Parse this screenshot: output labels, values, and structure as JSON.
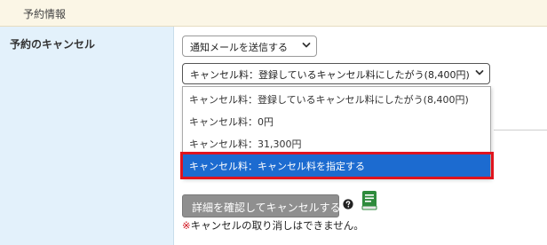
{
  "section": {
    "title": "予約情報"
  },
  "field": {
    "label": "予約のキャンセル"
  },
  "notify_select": {
    "selected": "通知メールを送信する"
  },
  "fee_select": {
    "selected": "キャンセル料：登録しているキャンセル料にしたがう(8,400円)",
    "options": [
      "キャンセル料：登録しているキャンセル料にしたがう(8,400円)",
      "キャンセル料：0円",
      "キャンセル料：31,300円",
      "キャンセル料：キャンセル料を指定する"
    ],
    "highlighted_option": "キャンセル料：キャンセル料を指定する"
  },
  "confirm_button": {
    "label": "詳細を確認してキャンセルする"
  },
  "notice": {
    "mark": "※",
    "text": "キャンセルの取り消しはできません。"
  },
  "colors": {
    "header_bg": "#fbf6e6",
    "label_bg": "#e3f1fb",
    "selected_option_bg": "#1c6bd0",
    "highlight_border": "#e0141e",
    "button_bg": "#8f8f8f",
    "manual_icon": "#2e8b3c"
  },
  "icons": {
    "help": "question-circle-icon",
    "manual": "book-icon",
    "dropdown": "chevron-down-icon"
  }
}
